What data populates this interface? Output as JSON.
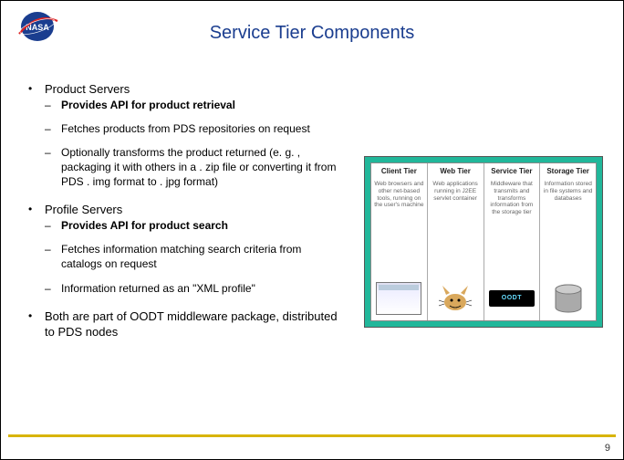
{
  "title": "Service Tier Components",
  "page_number": "9",
  "bullets": [
    {
      "heading": "Product Servers",
      "subs": [
        {
          "text": "Provides API for product retrieval",
          "bold": true
        },
        {
          "text": "Fetches products from PDS repositories on request",
          "bold": false
        },
        {
          "text": "Optionally transforms the product returned (e. g. , packaging it with others in a . zip file or converting it from PDS . img format to . jpg format)",
          "bold": false
        }
      ]
    },
    {
      "heading": "Profile Servers",
      "subs": [
        {
          "text": "Provides API for product search",
          "bold": true
        },
        {
          "text": "Fetches information matching search criteria from catalogs on request",
          "bold": false
        },
        {
          "text": "Information returned as an \"XML profile\"",
          "bold": false
        }
      ]
    },
    {
      "heading": "Both are part of OODT middleware package, distributed to PDS nodes",
      "subs": []
    }
  ],
  "diagram": {
    "cols": [
      {
        "title": "Client Tier",
        "desc": "Web browsers and other net-based tools, running on the user's machine"
      },
      {
        "title": "Web Tier",
        "desc": "Web applications running in J2EE servlet container"
      },
      {
        "title": "Service Tier",
        "desc": "Middleware that transmits and transforms information from the storage tier"
      },
      {
        "title": "Storage Tier",
        "desc": "Information stored in file systems and databases"
      }
    ],
    "oodt_label": "OODT"
  }
}
